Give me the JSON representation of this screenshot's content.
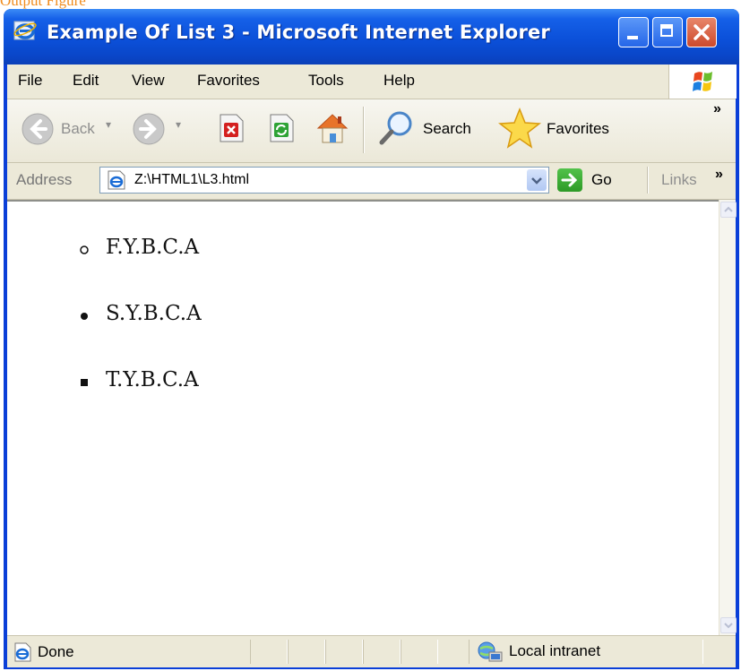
{
  "caption": "Output Figure",
  "window": {
    "title": "Example Of List 3 - Microsoft Internet Explorer"
  },
  "menu": [
    "File",
    "Edit",
    "View",
    "Favorites",
    "Tools",
    "Help"
  ],
  "toolbar": {
    "back_label": "Back",
    "search_label": "Search",
    "favorites_label": "Favorites"
  },
  "address": {
    "label": "Address",
    "url": "Z:\\HTML1\\L3.html",
    "go_label": "Go",
    "links_label": "Links"
  },
  "list_items": [
    {
      "text": "F.Y.B.C.A",
      "marker": "circle"
    },
    {
      "text": "S.Y.B.C.A",
      "marker": "disc"
    },
    {
      "text": "T.Y.B.C.A",
      "marker": "square"
    }
  ],
  "status": {
    "text": "Done",
    "zone": "Local intranet"
  },
  "colors": {
    "titlebar": "#0b50d9",
    "close_button": "#cc4a2c",
    "caption": "#f08c1e"
  },
  "icons": [
    "ie-logo-icon",
    "minimize-icon",
    "maximize-icon",
    "close-icon",
    "windows-logo-icon",
    "back-icon",
    "forward-icon",
    "stop-icon",
    "refresh-icon",
    "home-icon",
    "search-icon",
    "favorites-star-icon",
    "page-icon",
    "go-arrow-icon",
    "status-ie-icon",
    "local-intranet-icon"
  ]
}
